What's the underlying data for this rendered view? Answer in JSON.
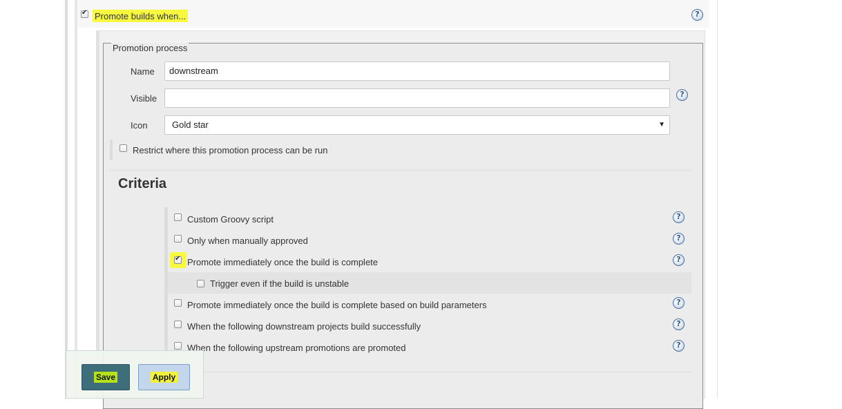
{
  "promote": {
    "label": "Promote builds when...",
    "checked": true
  },
  "help": {
    "glyph": "?"
  },
  "fieldset": {
    "legend": "Promotion process"
  },
  "form": {
    "name_label": "Name",
    "name_value": "downstream",
    "visible_label": "Visible",
    "visible_value": "",
    "icon_label": "Icon",
    "icon_value": "Gold star",
    "select_arrow": "▼",
    "restrict_label": "Restrict where this promotion process can be run"
  },
  "criteria": {
    "heading": "Criteria",
    "options": [
      {
        "label": "Custom Groovy script",
        "checked": false
      },
      {
        "label": "Only when manually approved",
        "checked": false
      },
      {
        "label": "Promote immediately once the build is complete",
        "checked": true
      },
      {
        "label": "Trigger even if the build is unstable",
        "checked": false
      },
      {
        "label": "Promote immediately once the build is complete based on build parameters",
        "checked": false
      },
      {
        "label": "When the following downstream projects build successfully",
        "checked": false
      },
      {
        "label": "When the following upstream promotions are promoted",
        "checked": false
      }
    ]
  },
  "buttons": {
    "save": "Save",
    "apply": "Apply"
  },
  "colors": {
    "highlight": "#f7f93f",
    "save_bg": "#3f6e7b",
    "apply_bg": "#c3d6ec",
    "help_ring": "#4a6f9e"
  }
}
